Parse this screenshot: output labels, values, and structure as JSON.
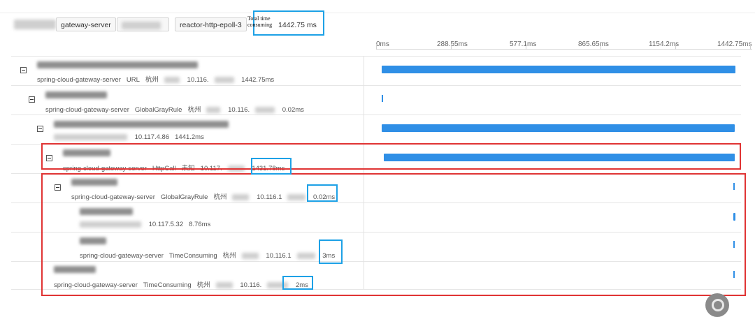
{
  "header": {
    "tags": [
      "gateway-server",
      "reactor-http-epoll-3"
    ],
    "total_label": "Total time consuming",
    "total_value": "1442.75 ms"
  },
  "timeline": {
    "ticks": [
      "0ms",
      "288.55ms",
      "577.1ms",
      "865.65ms",
      "1154.2ms",
      "1442.75ms"
    ]
  },
  "spans": [
    {
      "service": "spring-cloud-gateway-server",
      "method": "URL",
      "region": "杭州",
      "ip": "10.116.",
      "duration": "1442.75ms",
      "bar_start": 0.0,
      "bar_fraction": 1.0
    },
    {
      "service": "spring-cloud-gateway-server",
      "method": "GlobalGrayRule",
      "region": "杭州",
      "ip": "10.116.",
      "duration": "0.02ms",
      "bar_start": 0.0,
      "bar_fraction": 0.0
    },
    {
      "service": "",
      "method": "",
      "region": "",
      "ip": "10.117.4.86",
      "duration": "1441.2ms",
      "bar_start": 0.0,
      "bar_fraction": 0.999
    },
    {
      "service": "spring-cloud-gateway-server",
      "method": "HttpCall",
      "region": "未知",
      "ip": "10.117.",
      "duration": "1431.78ms",
      "bar_start": 0.006,
      "bar_fraction": 0.992
    },
    {
      "service": "spring-cloud-gateway-server",
      "method": "GlobalGrayRule",
      "region": "杭州",
      "ip": "10.116.1",
      "duration": "0.02ms",
      "bar_start": 0.994,
      "bar_fraction": 0.0
    },
    {
      "service": "",
      "method": "",
      "region": "",
      "ip": "10.117.5.32",
      "duration": "8.76ms",
      "bar_start": 0.994,
      "bar_fraction": 0.006
    },
    {
      "service": "spring-cloud-gateway-server",
      "method": "TimeConsuming",
      "region": "杭州",
      "ip": "10.116.1",
      "duration": "3ms",
      "bar_start": 0.994,
      "bar_fraction": 0.002
    },
    {
      "service": "spring-cloud-gateway-server",
      "method": "TimeConsuming",
      "region": "杭州",
      "ip": "10.116.",
      "duration": "2ms",
      "bar_start": 0.994,
      "bar_fraction": 0.0014
    }
  ],
  "colors": {
    "bar": "#2f8fe6",
    "highlight_red": "#e03434",
    "highlight_blue": "#1da1e6"
  }
}
